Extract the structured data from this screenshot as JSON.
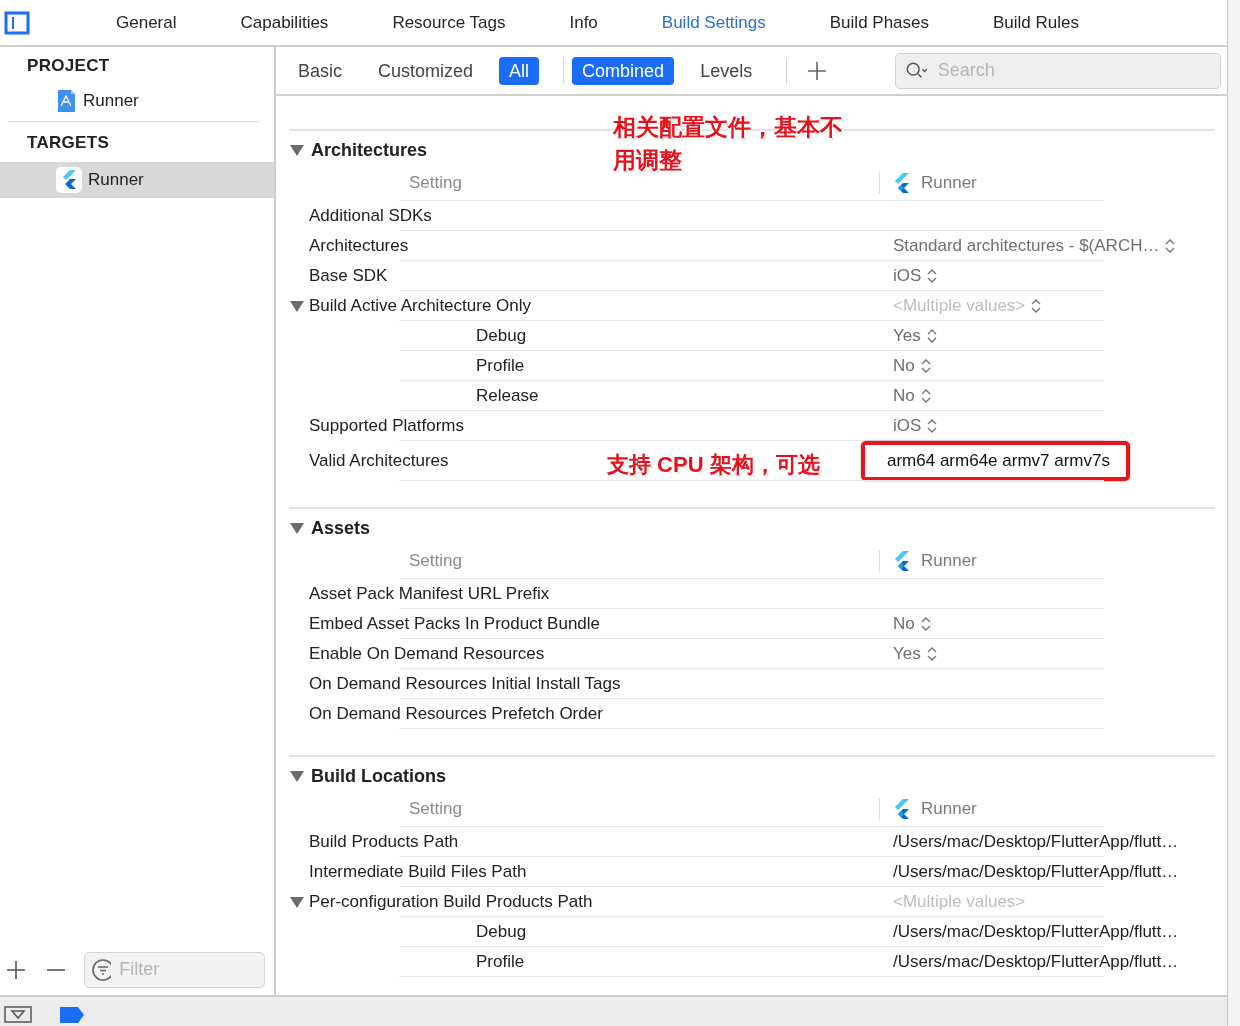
{
  "tabs": [
    {
      "label": "General",
      "selected": false
    },
    {
      "label": "Capabilities",
      "selected": false
    },
    {
      "label": "Resource Tags",
      "selected": false
    },
    {
      "label": "Info",
      "selected": false
    },
    {
      "label": "Build Settings",
      "selected": true
    },
    {
      "label": "Build Phases",
      "selected": false
    },
    {
      "label": "Build Rules",
      "selected": false
    }
  ],
  "sidebar": {
    "groups": [
      {
        "title": "PROJECT",
        "items": [
          {
            "label": "Runner",
            "kind": "project",
            "selected": false
          }
        ]
      },
      {
        "title": "TARGETS",
        "items": [
          {
            "label": "Runner",
            "kind": "target",
            "selected": true
          }
        ]
      }
    ],
    "filter": {
      "placeholder": "Filter"
    }
  },
  "filter_bar": {
    "scopes": [
      {
        "label": "Basic",
        "selected": false
      },
      {
        "label": "Customized",
        "selected": false
      },
      {
        "label": "All",
        "selected": true
      }
    ],
    "views": [
      {
        "label": "Combined",
        "selected": true
      },
      {
        "label": "Levels",
        "selected": false
      }
    ],
    "search": {
      "placeholder": "Search"
    }
  },
  "sections": [
    {
      "title": "Architectures",
      "expanded": true,
      "columns": [
        "Setting",
        "Runner"
      ],
      "note": "相关配置文件，基本不用调整",
      "rows": [
        {
          "name": "Additional SDKs"
        },
        {
          "name": "Architectures",
          "value": "Standard architectures  -  $(ARCH…",
          "kind": "popup",
          "customized": false,
          "mixed": false
        },
        {
          "name": "Base SDK",
          "value": "iOS",
          "kind": "popup",
          "customized": false,
          "mixed": false
        },
        {
          "name": "Build Active Architecture Only",
          "value": "<Multiple values>",
          "kind": "popup",
          "mixed": true,
          "expanded": true,
          "children": [
            {
              "name": "Debug",
              "value": "Yes",
              "kind": "popup",
              "customized": false,
              "mixed": false
            },
            {
              "name": "Profile",
              "value": "No",
              "kind": "popup",
              "customized": false,
              "mixed": false
            },
            {
              "name": "Release",
              "value": "No",
              "kind": "popup",
              "customized": false,
              "mixed": false
            }
          ]
        },
        {
          "name": "Supported Platforms",
          "value": "iOS",
          "kind": "popup",
          "customized": false,
          "mixed": false
        },
        {
          "name": "Valid Architectures",
          "value": "arm64 arm64e armv7 armv7s",
          "kind": "text",
          "customized": true,
          "mixed": false,
          "highlighted": true,
          "note": "支持 CPU 架构，可选"
        }
      ]
    },
    {
      "title": "Assets",
      "expanded": true,
      "columns": [
        "Setting",
        "Runner"
      ],
      "rows": [
        {
          "name": "Asset Pack Manifest URL Prefix"
        },
        {
          "name": "Embed Asset Packs In Product Bundle",
          "value": "No",
          "kind": "popup",
          "customized": false,
          "mixed": false
        },
        {
          "name": "Enable On Demand Resources",
          "value": "Yes",
          "kind": "popup",
          "customized": false,
          "mixed": false
        },
        {
          "name": "On Demand Resources Initial Install Tags"
        },
        {
          "name": "On Demand Resources Prefetch Order"
        }
      ]
    },
    {
      "title": "Build Locations",
      "expanded": true,
      "columns": [
        "Setting",
        "Runner"
      ],
      "rows": [
        {
          "name": "Build Products Path",
          "value": "/Users/mac/Desktop/FlutterApp/flutt…",
          "kind": "text",
          "customized": true,
          "mixed": false
        },
        {
          "name": "Intermediate Build Files Path",
          "value": "/Users/mac/Desktop/FlutterApp/flutt…",
          "kind": "text",
          "customized": true,
          "mixed": false
        },
        {
          "name": "Per-configuration Build Products Path",
          "value": "<Multiple values>",
          "kind": "text",
          "mixed": true,
          "expanded": true,
          "children": [
            {
              "name": "Debug",
              "value": "/Users/mac/Desktop/FlutterApp/flutt…",
              "kind": "text",
              "customized": true,
              "mixed": false
            },
            {
              "name": "Profile",
              "value": "/Users/mac/Desktop/FlutterApp/flutt…",
              "kind": "text",
              "customized": true,
              "mixed": false
            }
          ]
        }
      ]
    }
  ]
}
